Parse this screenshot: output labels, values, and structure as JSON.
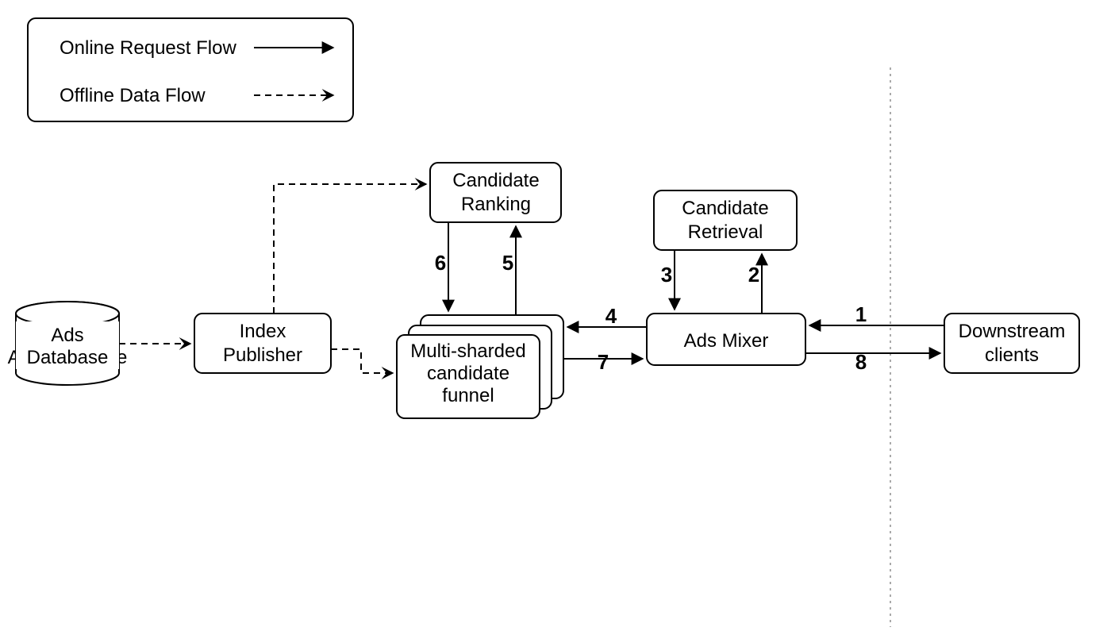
{
  "legend": {
    "online": "Online Request Flow",
    "offline": "Offline Data Flow"
  },
  "nodes": {
    "ads_db": "Ads Database",
    "index_publisher_l1": "Index",
    "index_publisher_l2": "Publisher",
    "candidate_ranking_l1": "Candidate",
    "candidate_ranking_l2": "Ranking",
    "candidate_retrieval_l1": "Candidate",
    "candidate_retrieval_l2": "Retrieval",
    "funnel_l1": "Multi-sharded",
    "funnel_l2": "candidate",
    "funnel_l3": "funnel",
    "ads_mixer": "Ads Mixer",
    "downstream_l1": "Downstream",
    "downstream_l2": "clients"
  },
  "edges": {
    "n1": "1",
    "n2": "2",
    "n3": "3",
    "n4": "4",
    "n5": "5",
    "n6": "6",
    "n7": "7",
    "n8": "8"
  }
}
